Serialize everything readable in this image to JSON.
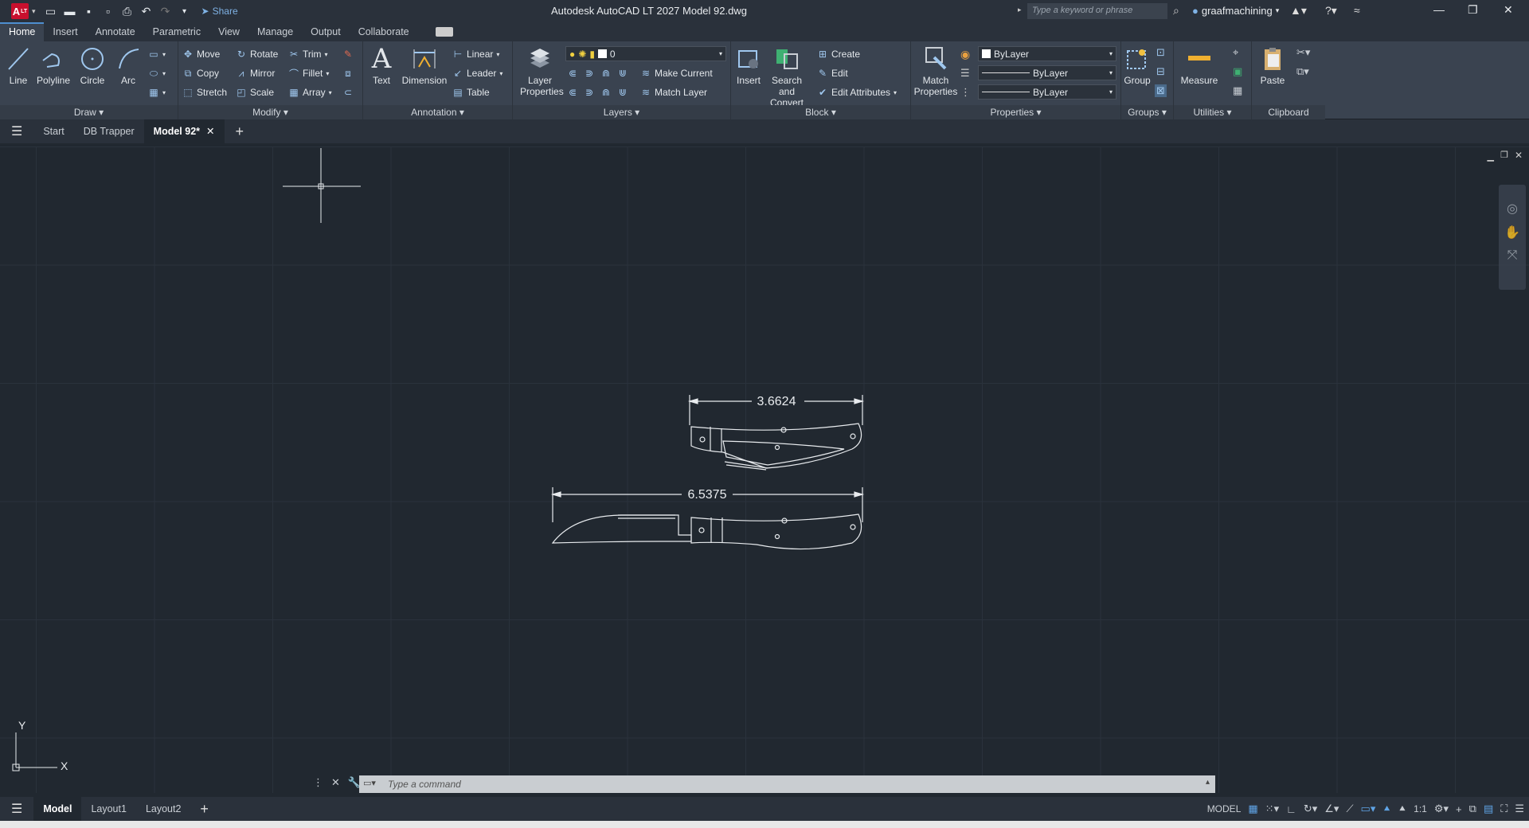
{
  "app": {
    "logo": "A",
    "logo_sub": "LT",
    "title": "Autodesk AutoCAD LT 2027   Model 92.dwg",
    "share_label": "Share",
    "search_placeholder": "Type a keyword or phrase",
    "user": "graafmachining"
  },
  "ribbon_tabs": [
    "Home",
    "Insert",
    "Annotate",
    "Parametric",
    "View",
    "Manage",
    "Output",
    "Collaborate"
  ],
  "panels": {
    "draw": {
      "label": "Draw",
      "line": "Line",
      "polyline": "Polyline",
      "circle": "Circle",
      "arc": "Arc"
    },
    "modify": {
      "label": "Modify",
      "move": "Move",
      "rotate": "Rotate",
      "trim": "Trim",
      "copy": "Copy",
      "mirror": "Mirror",
      "fillet": "Fillet",
      "stretch": "Stretch",
      "scale": "Scale",
      "array": "Array"
    },
    "annotation": {
      "label": "Annotation",
      "text": "Text",
      "dimension": "Dimension",
      "linear": "Linear",
      "leader": "Leader",
      "table": "Table"
    },
    "layers": {
      "label": "Layers",
      "layer_properties": "Layer Properties",
      "current_layer": "0",
      "make_current": "Make Current",
      "match_layer": "Match Layer"
    },
    "block": {
      "label": "Block",
      "insert": "Insert",
      "search_convert": "Search and Convert",
      "create": "Create",
      "edit": "Edit",
      "edit_attributes": "Edit Attributes"
    },
    "properties": {
      "label": "Properties",
      "match_properties": "Match Properties",
      "color": "ByLayer",
      "linetype": "ByLayer",
      "lineweight": "ByLayer"
    },
    "groups": {
      "label": "Groups",
      "group": "Group"
    },
    "utilities": {
      "label": "Utilities",
      "measure": "Measure"
    },
    "clipboard": {
      "label": "Clipboard",
      "paste": "Paste"
    }
  },
  "doc_tabs": [
    "Start",
    "DB Trapper",
    "Model 92*"
  ],
  "drawing": {
    "dim_top": "3.6624",
    "dim_bottom": "6.5375"
  },
  "ucs": {
    "x": "X",
    "y": "Y"
  },
  "command": {
    "placeholder": "Type a command"
  },
  "layout_tabs": [
    "Model",
    "Layout1",
    "Layout2"
  ],
  "status": {
    "model": "MODEL",
    "scale": "1:1"
  },
  "colors": {
    "accent": "#4e8fd0",
    "canvas": "#212830",
    "ribbon": "#3a4350"
  }
}
